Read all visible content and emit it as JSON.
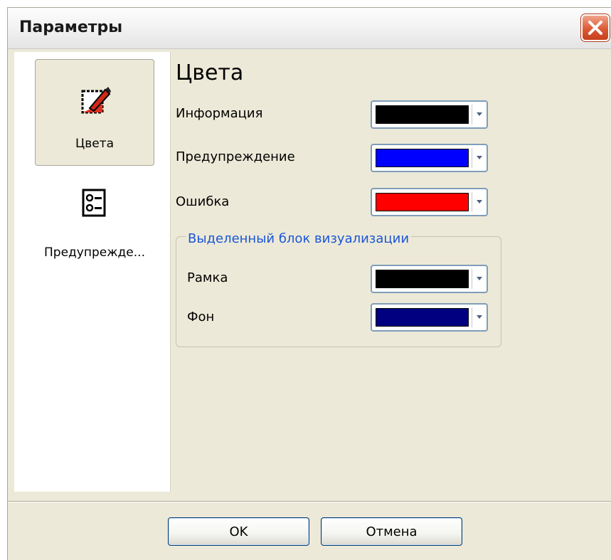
{
  "window": {
    "title": "Параметры"
  },
  "sidebar": {
    "items": [
      {
        "label": "Цвета",
        "icon": "palette-icon",
        "selected": true
      },
      {
        "label": "Предупрежде...",
        "icon": "warnings-list-icon",
        "selected": false
      }
    ]
  },
  "content": {
    "title": "Цвета",
    "rows": [
      {
        "label": "Информация",
        "color": "#000000"
      },
      {
        "label": "Предупреждение",
        "color": "#0000ff"
      },
      {
        "label": "Ошибка",
        "color": "#ff0000"
      }
    ],
    "group": {
      "title": "Выделенный блок визуализации",
      "rows": [
        {
          "label": "Рамка",
          "color": "#000000"
        },
        {
          "label": "Фон",
          "color": "#000080"
        }
      ]
    }
  },
  "buttons": {
    "ok": "OK",
    "cancel": "Отмена"
  }
}
